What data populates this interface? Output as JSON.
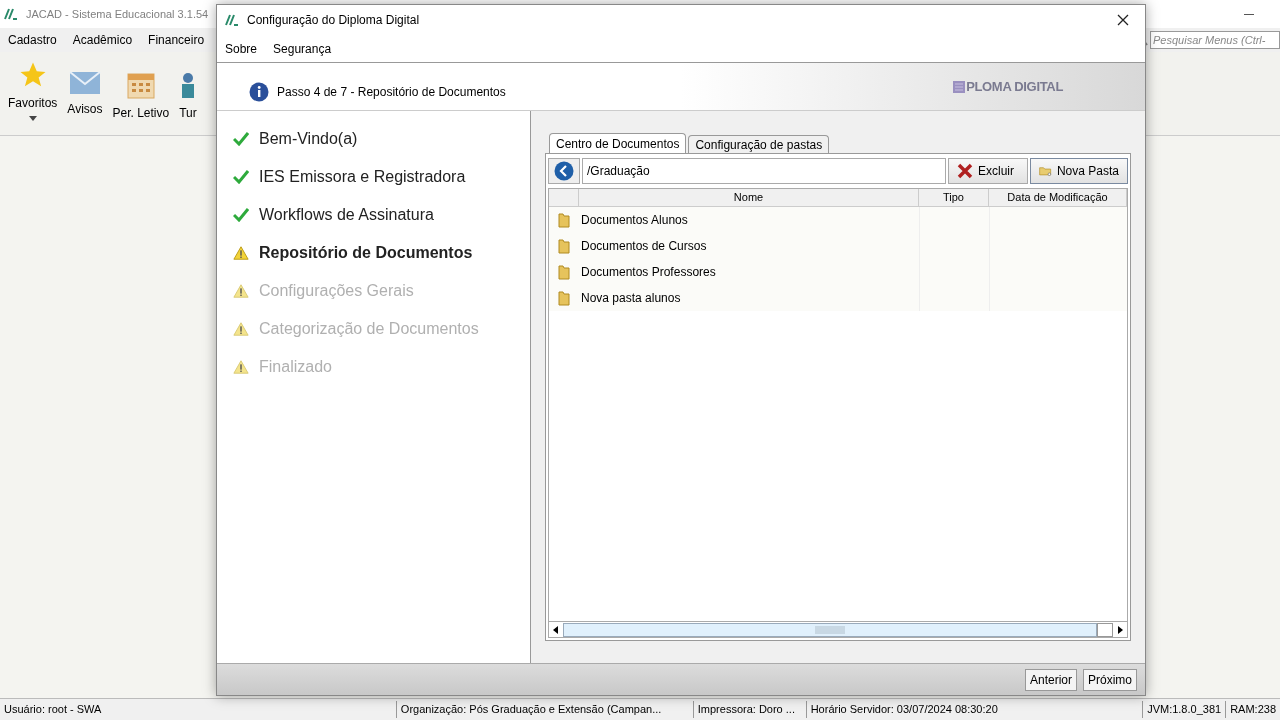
{
  "app": {
    "title": "JACAD - Sistema Educacional 3.1.54",
    "menu": [
      "Cadastro",
      "Acadêmico",
      "Financeiro"
    ],
    "toolbar": [
      {
        "kind": "star",
        "label": "Favoritos"
      },
      {
        "kind": "mail",
        "label": "Avisos"
      },
      {
        "kind": "calendar",
        "label": "Per. Letivo"
      },
      {
        "kind": "people",
        "label": "Tur"
      }
    ],
    "search": {
      "placeholder": "Pesquisar Menus (Ctrl-"
    },
    "status_bar": [
      "Usuário: root - SWA",
      "Organização: Pós Graduação e Extensão (Campan...",
      "Impressora: Doro ...",
      "Horário Servidor: 03/07/2024 08:30:20",
      "JVM:1.8.0_381",
      "RAM:238"
    ]
  },
  "dialog": {
    "title": "Configuração do Diploma Digital",
    "menu": [
      "Sobre",
      "Segurança"
    ],
    "step_info": "Passo 4 de 7 - Repositório de Documentos",
    "logo": "PLOMA DIGITAL",
    "steps": [
      {
        "label": "Bem-Vindo(a)",
        "kind": "done"
      },
      {
        "label": "IES Emissora e Registradora",
        "kind": "done"
      },
      {
        "label": "Workflows de Assinatura",
        "kind": "done"
      },
      {
        "label": "Repositório de Documentos",
        "kind": "current"
      },
      {
        "label": "Configurações Gerais",
        "kind": "pending"
      },
      {
        "label": "Categorização de Documentos",
        "kind": "pending"
      },
      {
        "label": "Finalizado",
        "kind": "pending"
      }
    ],
    "tabs": [
      {
        "label": "Centro de Documentos",
        "selected": true
      },
      {
        "label": "Configuração de pastas",
        "selected": false
      }
    ],
    "path": "/Graduação",
    "buttons": [
      {
        "kind": "delete",
        "label": "Excluir"
      },
      {
        "kind": "folder",
        "label": "Nova Pasta"
      }
    ],
    "table": {
      "columns": [
        "Nome",
        "Tipo",
        "Data de Modificação"
      ],
      "rows": [
        {
          "name": "Documentos Alunos"
        },
        {
          "name": "Documentos de Cursos"
        },
        {
          "name": "Documentos Professores"
        },
        {
          "name": "Nova pasta alunos"
        }
      ]
    },
    "footer_buttons": [
      "Anterior",
      "Próximo"
    ]
  }
}
